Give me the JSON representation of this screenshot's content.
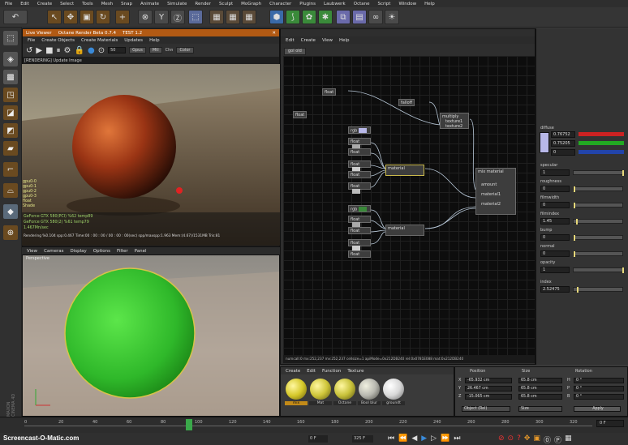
{
  "menu": [
    "File",
    "Edit",
    "Create",
    "Select",
    "Tools",
    "Mesh",
    "Snap",
    "Animate",
    "Simulate",
    "Render",
    "Sculpt",
    "MoGraph",
    "Character",
    "Plugins",
    "Laubwerk",
    "Octane",
    "Script",
    "Window",
    "Help"
  ],
  "viewer": {
    "title": "Live Viewer",
    "subtitle": "Octane Render Beta 0.7.4",
    "build": "TEST 1.2",
    "menu": [
      "File",
      "Create Objects",
      "Create Materials",
      "Updates",
      "Help"
    ],
    "toolbar_value": "50",
    "toolbar_buttons": [
      "Gpus",
      "Mtl",
      "Chn",
      "Color"
    ],
    "status_top": "[RENDERING] Update Image",
    "stats": [
      "gpu0-0",
      "gpu0-1",
      "gpu0-2",
      "gpu0-3",
      "float",
      "Shade"
    ],
    "gpu1": "GeForce GTX 580(PCI) %62 temp89",
    "gpu2": "GeForce GTX 580(2) %61 temp79",
    "mem": "1.467Mn/sec",
    "status_bottom": "Rendering %0.104 spp:0.467 Time:00 : 00 : 00 / 00 : 00 : 00(sec) spp/maxspp:1.963 Mem:(4.67)/1531MB Tris:81"
  },
  "viewport": {
    "menu": [
      "View",
      "Cameras",
      "Display",
      "Options",
      "Filter",
      "Panel"
    ],
    "label": "Perspective"
  },
  "node_editor": {
    "menu": [
      "Edit",
      "Create",
      "View",
      "Help"
    ],
    "tab": "gol old",
    "nodes": {
      "float1": "float",
      "float2": "float",
      "falloff": "falloff",
      "multiply": "multiply",
      "texture1": "texture1",
      "texture2": "texture2",
      "rgb1": "rgb",
      "rgb2": "rgb",
      "float_list": [
        "float",
        "float",
        "float",
        "float",
        "float"
      ],
      "float_list2": [
        "float",
        "float",
        "float",
        "float"
      ],
      "material1": "material",
      "material2": "material",
      "mixmat": "mix material",
      "mix_ports": [
        "amount",
        "material1",
        "material2"
      ]
    },
    "status": "numcall:0 mx:252,237 mv:252,237 cellsize=1 apiMode=0x212DB240 rel:0x0781E088  mat:0x212DB240"
  },
  "attributes": {
    "diffuse_label": "diffuse",
    "diffuse_vals": [
      "0.76752",
      "0.75205",
      "0"
    ],
    "specular_label": "specular",
    "specular_val": "1",
    "roughness_label": "roughness",
    "roughness_val": "0",
    "filmwidth_label": "filmwidth",
    "filmwidth_val": "0",
    "filmindex_label": "filmindex",
    "filmindex_val": "1.45",
    "bump_label": "bump",
    "bump_val": "0",
    "normal_label": "normal",
    "normal_val": "0",
    "opacity_label": "opacity",
    "opacity_val": "1",
    "index_label": "index",
    "index_val": "2.52475",
    "colors": {
      "diffuse": "#b8b8e8",
      "bar_red": "#cc2222",
      "bar_green": "#22aa22"
    }
  },
  "materials": {
    "menu": [
      "Create",
      "Edit",
      "Function",
      "Texture"
    ],
    "items": [
      "mix",
      "Mat",
      "Octane",
      "Bool blur",
      "groundt"
    ],
    "colors": [
      "#d6c92b",
      "#cfc63a",
      "#c8c23a",
      "#b8b8b0",
      "#d8d8d8"
    ]
  },
  "coords": {
    "headers": [
      "Position",
      "Size",
      "Rotation"
    ],
    "rows": [
      {
        "axis": "X",
        "pos": "-65.932 cm",
        "size": "65.8 cm",
        "rotaxis": "H",
        "rot": "0 °"
      },
      {
        "axis": "Y",
        "pos": "26.467 cm",
        "size": "65.8 cm",
        "rotaxis": "P",
        "rot": "0 °"
      },
      {
        "axis": "Z",
        "pos": "-15.065 cm",
        "size": "65.8 cm",
        "rotaxis": "B",
        "rot": "0 °"
      }
    ],
    "mode1": "Object (Rel)",
    "mode2": "Size",
    "apply": "Apply"
  },
  "timeline": {
    "ticks": [
      "0",
      "20",
      "40",
      "60",
      "80",
      "100",
      "120",
      "140",
      "160",
      "180",
      "200",
      "220",
      "240",
      "260",
      "280",
      "300",
      "320"
    ],
    "current_frame": "0 F",
    "start": "0 F",
    "end": "325 F",
    "fps": "30 F"
  },
  "watermark": "Screencast-O-Matic.com",
  "side_label": "MAXON CINEMA 4D"
}
